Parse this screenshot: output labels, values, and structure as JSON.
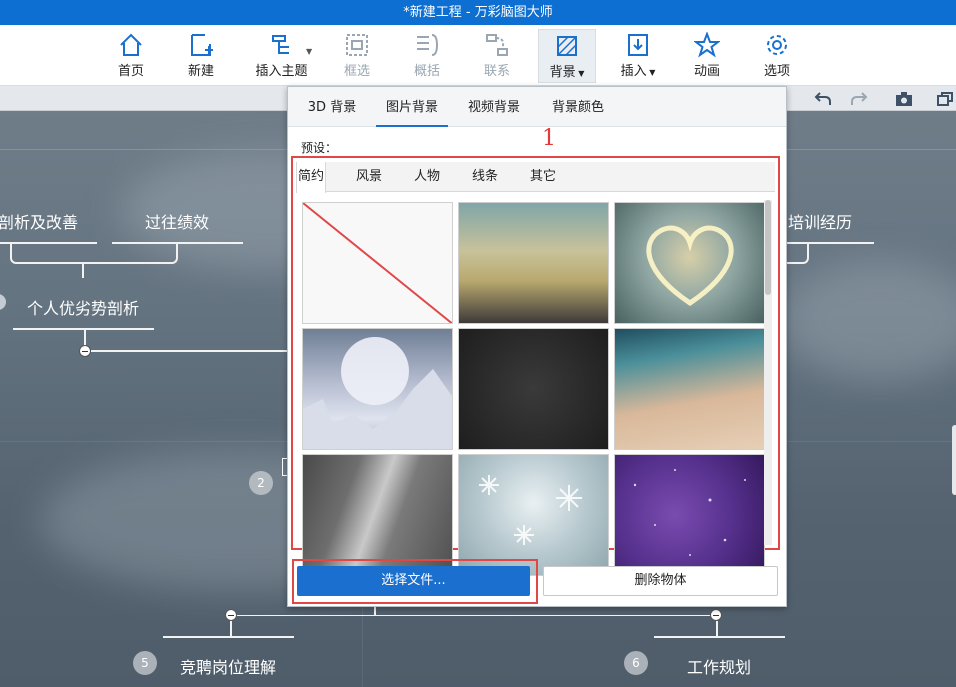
{
  "window": {
    "title": "*新建工程 - 万彩脑图大师"
  },
  "toolbar": {
    "items": [
      {
        "label": "首页",
        "icon": "home-icon",
        "enabled": true
      },
      {
        "label": "新建",
        "icon": "new-icon",
        "enabled": true
      },
      {
        "label": "插入主题",
        "icon": "insert-topic-icon",
        "enabled": true
      },
      {
        "label": "框选",
        "icon": "box-select-icon",
        "enabled": false
      },
      {
        "label": "概括",
        "icon": "summary-icon",
        "enabled": false
      },
      {
        "label": "联系",
        "icon": "relation-icon",
        "enabled": false
      },
      {
        "label": "背景",
        "icon": "background-icon",
        "enabled": true,
        "selected": true
      },
      {
        "label": "插入",
        "icon": "insert-icon",
        "enabled": true
      },
      {
        "label": "动画",
        "icon": "animation-icon",
        "enabled": true
      },
      {
        "label": "选项",
        "icon": "options-icon",
        "enabled": true
      }
    ]
  },
  "subbar": {
    "icons": [
      "undo-icon",
      "redo-icon",
      "camera-icon",
      "window-icon"
    ]
  },
  "mindmap": {
    "nodes": [
      "剖析及改善",
      "过往绩效",
      "个人优劣势剖析",
      "培训经历",
      "竞聘岗位理解",
      "工作规划"
    ],
    "badges": [
      "2",
      "5",
      "6"
    ]
  },
  "panel": {
    "tabs": [
      "3D 背景",
      "图片背景",
      "视频背景",
      "背景颜色"
    ],
    "active_tab": "图片背景",
    "preset_label": "预设：",
    "category_tabs": [
      "简约",
      "风景",
      "人物",
      "线条",
      "其它"
    ],
    "active_category": "简约",
    "thumbnails": [
      "none",
      "hexagon-gradient",
      "glowing-heart",
      "planet-landscape",
      "dark-texture",
      "teal-sand",
      "brushed-metal",
      "snowflakes",
      "purple-stars"
    ],
    "choose_button": "选择文件...",
    "delete_button": "删除物体"
  },
  "annotations": {
    "first": "1",
    "second": "2"
  },
  "colors": {
    "titlebar": "#0d6fd1",
    "accent": "#1a6fcf",
    "annotation": "#e04848"
  }
}
